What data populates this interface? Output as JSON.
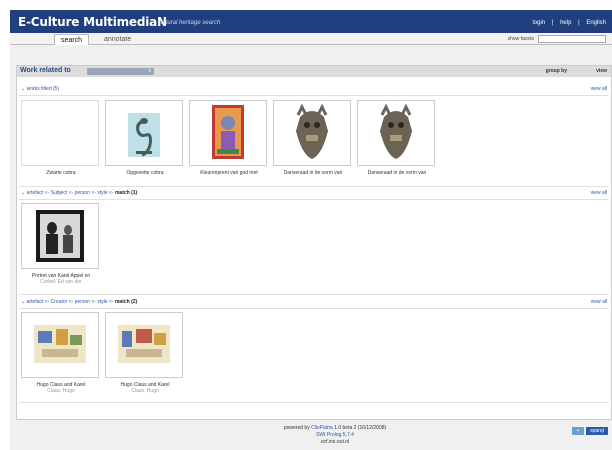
{
  "app": {
    "brand": "E-Culture MultimediaN",
    "tagline": "cultural heritage search",
    "links": [
      "login",
      "|",
      "help",
      "|",
      "English"
    ]
  },
  "tabs": [
    {
      "label": "search",
      "active": true
    },
    {
      "label": "annotate",
      "active": false
    }
  ],
  "facets_label": "show facets",
  "search_box_value": "",
  "panel": {
    "title": "Work related to",
    "chip_label": "",
    "chip_close": "x",
    "group_by": "group by",
    "view": "view"
  },
  "sections": [
    {
      "label": "works titled (5)",
      "view_all": "view all",
      "items": [
        {
          "caption": "Zwarte cobra",
          "subcaption": ""
        },
        {
          "caption": "Opgezette cobra",
          "subcaption": ""
        },
        {
          "caption": "Kleurenprent van god met",
          "subcaption": ""
        },
        {
          "caption": "Danseraad in de vorm van",
          "subcaption": ""
        },
        {
          "caption": "Danseraad in de vorm van",
          "subcaption": ""
        }
      ]
    },
    {
      "label_prefix": "artefact <- Subject <- person <- style <- ",
      "label_strong": "match (1)",
      "view_all": "view all",
      "items": [
        {
          "caption": "Portret van Karel Appel en",
          "subcaption": "Corbel, Ed van der"
        }
      ]
    },
    {
      "label_prefix": "artefact <- Creator <- person <- style <- ",
      "label_strong": "match (2)",
      "view_all": "view all",
      "items": [
        {
          "caption": "Hugo Claus and Karel",
          "subcaption": "Claus, Hugo"
        },
        {
          "caption": "Hugo Claus and Karel",
          "subcaption": "Claus, Hugo"
        }
      ]
    }
  ],
  "footer": {
    "line1_prefix": "powered by ",
    "line1_link": "ClioPatria",
    "line1_suffix": " 1.0 beta 2 (16/12/2008)",
    "line2": "SWI Prolog 5.7.4",
    "line3": "ecf.ins.cwi.nl",
    "badge": "sparql",
    "badge_small": "+"
  }
}
